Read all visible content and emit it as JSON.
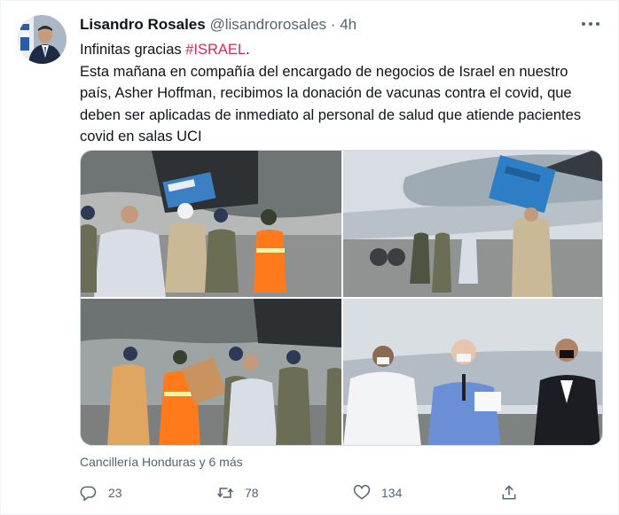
{
  "tweet": {
    "author_name": "Lisandro Rosales",
    "author_handle": "@lisandrorosales",
    "separator": "·",
    "time": "4h",
    "line1_prefix": "Infinitas gracias ",
    "hashtag": "#ISRAEL",
    "line1_suffix": ".",
    "body": "Esta mañana  en compañía del encargado de negocios de Israel en nuestro país, Asher Hoffman, recibimos la donación de vacunas contra el covid, que deben ser aplicadas de inmediato al personal de salud que atiende pacientes covid en salas UCI",
    "tagged": "Cancillería Honduras y 6 más",
    "reply_count": "23",
    "retweet_count": "78",
    "like_count": "134"
  },
  "icons": {
    "more": "more-icon",
    "reply": "reply-icon",
    "retweet": "retweet-icon",
    "like": "heart-icon",
    "share": "share-icon"
  },
  "colors": {
    "hashtag": "#e0245e",
    "secondary_text": "#536471",
    "primary_text": "#0f1419"
  }
}
